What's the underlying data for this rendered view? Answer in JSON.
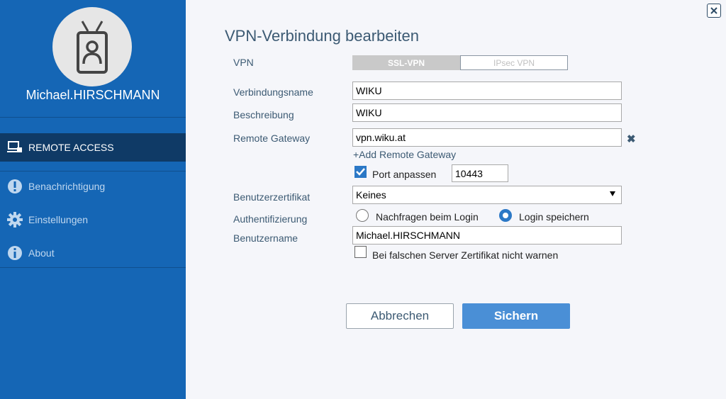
{
  "sidebar": {
    "username": "Michael.HIRSCHMANN",
    "nav": [
      {
        "label": "REMOTE ACCESS",
        "icon": "remote-access-icon",
        "active": true
      },
      {
        "label": "Benachrichtigung",
        "icon": "alert-icon",
        "active": false
      },
      {
        "label": "Einstellungen",
        "icon": "gear-icon",
        "active": false
      },
      {
        "label": "About",
        "icon": "info-icon",
        "active": false
      }
    ]
  },
  "form": {
    "title": "VPN-Verbindung bearbeiten",
    "vpn_label": "VPN",
    "vpn_options": [
      "SSL-VPN",
      "IPsec VPN"
    ],
    "vpn_selected": "SSL-VPN",
    "name_label": "Verbindungsname",
    "name_value": "WIKU",
    "desc_label": "Beschreibung",
    "desc_value": "WIKU",
    "gateway_label": "Remote Gateway",
    "gateway_value": "vpn.wiku.at",
    "add_gateway_label": "+Add Remote Gateway",
    "port_checkbox_label": "Port anpassen",
    "port_checked": true,
    "port_value": "10443",
    "cert_label": "Benutzerzertifikat",
    "cert_value": "Keines",
    "auth_label": "Authentifizierung",
    "auth_options": [
      "Nachfragen beim Login",
      "Login speichern"
    ],
    "auth_selected": "Login speichern",
    "username_label": "Benutzername",
    "username_value": "Michael.HIRSCHMANN",
    "warn_checkbox_label": "Bei falschen Server Zertifikat nicht warnen",
    "warn_checked": false,
    "cancel_label": "Abbrechen",
    "save_label": "Sichern"
  },
  "colors": {
    "sidebar_bg": "#1566b5",
    "sidebar_active": "#0f3a66",
    "accent": "#2b78c6",
    "save_button": "#4a8fd6",
    "label_text": "#3c5a73"
  }
}
